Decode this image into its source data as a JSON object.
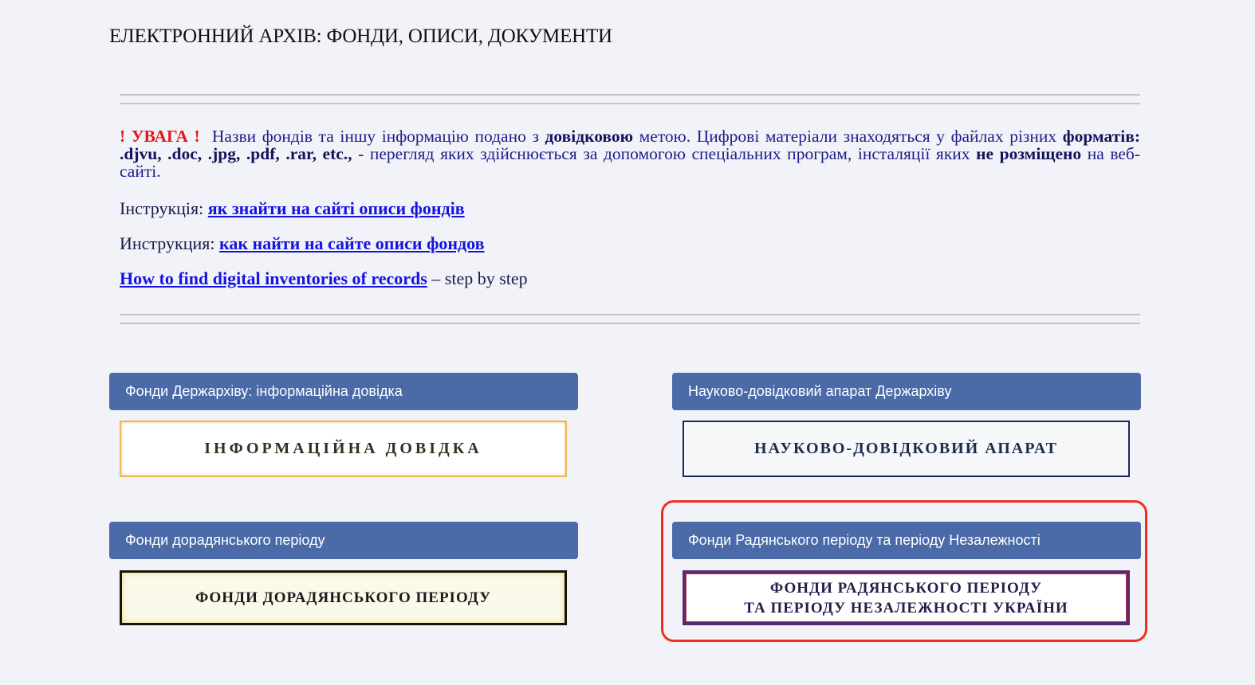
{
  "page": {
    "title": "ЕЛЕКТРОННИЙ АРХІВ: ФОНДИ, ОПИСИ, ДОКУМЕНТИ"
  },
  "notice": {
    "warning_label": "! УВАГА !",
    "text_1": "Назви фондів та іншу інформацію подано з",
    "bold_1": "довідковою",
    "text_2": "метою. Цифрові матеріали знаходяться у файлах різних",
    "bold_2": "форматів: .djvu, .doc, .jpg, .pdf, .rar, etc.,",
    "text_3": "- перегляд яких здійснюється за допомогою спеціальних програм, інсталяції яких",
    "bold_3": "не розміщено",
    "text_4": "на веб-сайті."
  },
  "instructions": [
    {
      "prefix": "Інструкція:",
      "link": "як знайти на сайті описи фондів",
      "suffix": ""
    },
    {
      "prefix": "Инструкция:",
      "link": "как найти на сайте описи фондов",
      "suffix": ""
    },
    {
      "prefix": "",
      "link": "How to find digital inventories of records",
      "suffix": "– step by step"
    }
  ],
  "cards": [
    {
      "header": "Фонди Держархіву: інформаційна довідка",
      "banner": "ІНФОРМАЦІЙНА ДОВІДКА"
    },
    {
      "header": "Науково-довідковий апарат Держархіву",
      "banner": "НАУКОВО-ДОВІДКОВИЙ АПАРАТ"
    },
    {
      "header": "Фонди дорадянського періоду",
      "banner": "ФОНДИ ДОРАДЯНСЬКОГО ПЕРІОДУ"
    },
    {
      "header": "Фонди Радянського періоду та періоду Незалежності",
      "banner_line_1": "ФОНДИ РАДЯНСЬКОГО ПЕРІОДУ",
      "banner_line_2": "ТА ПЕРІОДУ НЕЗАЛЕЖНОСТІ УКРАЇНИ",
      "highlighted": true
    }
  ],
  "colors": {
    "header_bg": "#4a6aa8",
    "warning": "#e8141a",
    "link": "#1414e0",
    "highlight": "#f0301c",
    "page_bg": "#f2f3f8"
  }
}
